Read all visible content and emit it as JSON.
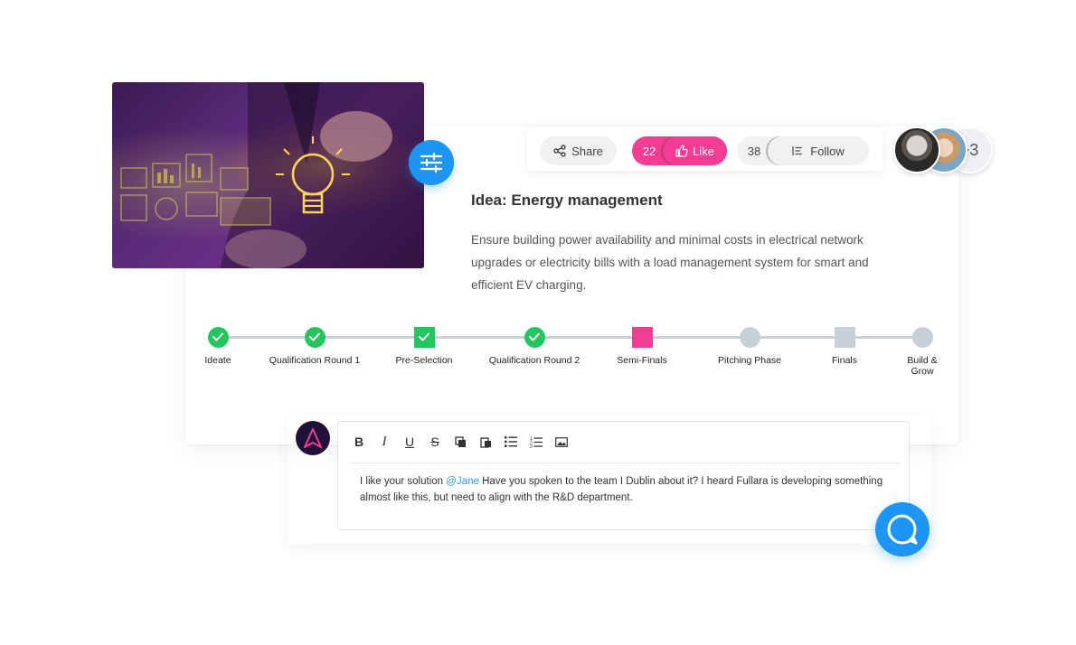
{
  "idea": {
    "title": "Idea: Energy management",
    "description": "Ensure building power availability and minimal costs in electrical network upgrades or electricity bills with a load management system for smart and efficient EV charging."
  },
  "actions": {
    "share_label": "Share",
    "like_count": "22",
    "like_label": "Like",
    "follow_count": "38",
    "follow_label": "Follow"
  },
  "followers": {
    "more_label": "+3"
  },
  "timeline": {
    "steps": [
      {
        "label": "Ideate",
        "status": "done-circle"
      },
      {
        "label": "Qualification Round 1",
        "status": "done-circle"
      },
      {
        "label": "Pre-Selection",
        "status": "done-square"
      },
      {
        "label": "Qualification Round 2",
        "status": "done-circle"
      },
      {
        "label": "Semi-Finals",
        "status": "current-square"
      },
      {
        "label": "Pitching Phase",
        "status": "pending-circle"
      },
      {
        "label": "Finals",
        "status": "pending-square"
      },
      {
        "label": "Build & Grow",
        "status": "pending-circle"
      }
    ]
  },
  "comment": {
    "text_before": "I like your solution ",
    "mention": "@Jane",
    "text_after": " Have you spoken to the team I Dublin about it? I heard Fullara is developing something almost like this, but need to align with the R&D department."
  },
  "colors": {
    "accent_blue": "#1e95f2",
    "like_pink": "#f23d93",
    "done_green": "#22c55e",
    "current_pink": "#f23d93",
    "pending_gray": "#c7d0d9"
  }
}
